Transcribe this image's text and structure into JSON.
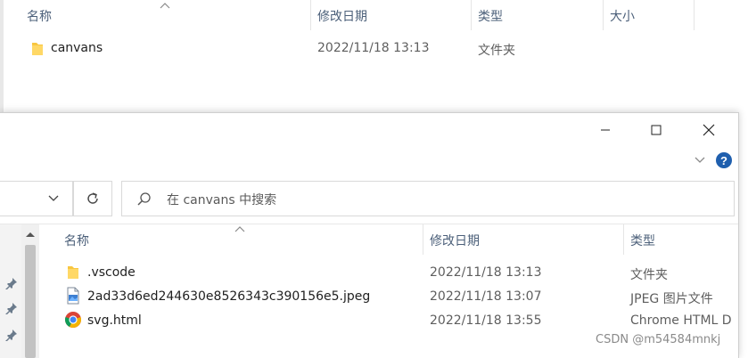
{
  "background_window": {
    "columns": [
      "名称",
      "修改日期",
      "类型",
      "大小"
    ],
    "rows": [
      {
        "name": "canvans",
        "date": "2022/11/18 13:13",
        "type": "文件夹",
        "icon": "folder-icon"
      }
    ]
  },
  "front_window": {
    "search": {
      "placeholder": "在 canvans 中搜索"
    },
    "columns": [
      "名称",
      "修改日期",
      "类型"
    ],
    "rows": [
      {
        "name": ".vscode",
        "date": "2022/11/18 13:13",
        "type": "文件夹",
        "icon": "folder-icon"
      },
      {
        "name": "2ad33d6ed244630e8526343c390156e5.jpeg",
        "date": "2022/11/18 13:07",
        "type": "JPEG 图片文件",
        "icon": "image-file-icon"
      },
      {
        "name": "svg.html",
        "date": "2022/11/18 13:55",
        "type": "Chrome HTML D",
        "icon": "chrome-icon"
      }
    ]
  },
  "watermark": "CSDN @m54584mnkj",
  "colors": {
    "folder": "#f8c640",
    "accent": "#1f5fae",
    "header_text": "#4c607a"
  }
}
